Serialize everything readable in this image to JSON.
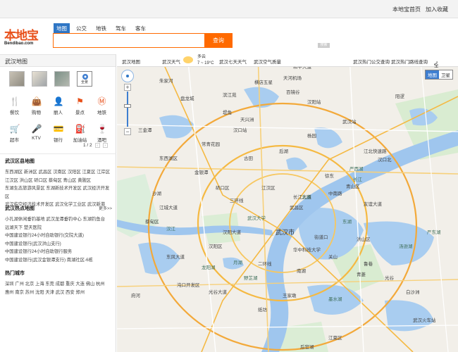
{
  "topbar": {
    "home": "本地宝首页",
    "fav": "加入收藏"
  },
  "logo": {
    "cn": "本地宝",
    "en": "Bendibao.com"
  },
  "search": {
    "tabs": [
      "地图",
      "公交",
      "地铁",
      "驾车",
      "客车"
    ],
    "button": "查询",
    "small_button": "搜索"
  },
  "sidebar": {
    "title": "武汉地图",
    "thumbs": [
      "",
      "",
      "",
      "全景"
    ],
    "poi": [
      "餐饮",
      "购物",
      "丽人",
      "景点",
      "地铁",
      "超市",
      "KTV",
      "银行",
      "加油站",
      "酒吧"
    ],
    "pager": {
      "text": "1 / 2",
      "prev": "‹",
      "next": "›"
    },
    "districts": {
      "title": "武汉区县地图",
      "lines": [
        "东西湖区 新洲区 武昌区 汉南区 汉阳区 江夏区 江岸区",
        "江汉区 洪山区 硚口区 蔡甸区 青山区 黄陂区",
        "东湖生态旅游风景区 东湖新技术开发区 武汉经济开发区",
        "武汉临空经济技术开发区 武汉化学工业区 武汉新港"
      ]
    },
    "hot": {
      "title": "武汉热点地图",
      "more": "更多>>",
      "lines": [
        "小孔湖休闲垂钓基地 武汉龙潭垂钓中心 东湖钓鱼台",
        "远湖天下 楚天医院",
        "中国建设银行24小时自助银行(交院大道)",
        "中国建设银行(武汉洪山支行)",
        "中国建设银行24小时自助银行服务",
        "中国建设银行(武汉金银潭支行) 南湖社区-6栋"
      ]
    },
    "cities": {
      "title": "热门城市",
      "lines": [
        "深圳 广州 北京 上海 东莞 成都 重庆 大连 佛山 杭州",
        "惠州 南京 苏州 沈阳 天津 武汉 西安 郑州"
      ]
    }
  },
  "mapbar": {
    "title": "武汉地图",
    "weather_link": "武汉天气",
    "weather": {
      "cond": "多云",
      "temp": "7 ~ 19°C"
    },
    "week": "武汉七天天气",
    "air": "武汉空气质量",
    "bus": "武汉热门公交查询",
    "route": "武汉热门路线查询",
    "full": "全屏"
  },
  "maptype": [
    "地图",
    "卫星"
  ],
  "zoom": {
    "plus": "+",
    "minus": "−"
  },
  "map_labels": [
    "天河机场",
    "滨江苑",
    "横店五星",
    "百镜谷",
    "武汉站",
    "阳逻",
    "汉口站",
    "江汉区",
    "硚口区",
    "东西湖区",
    "汉阳区",
    "武昌区",
    "武汉市",
    "青山区",
    "洪山区",
    "蔡甸区",
    "沌口开发区",
    "江夏区",
    "南湖",
    "后湖",
    "盘龙城",
    "常青花园",
    "三环线",
    "二环线",
    "长江",
    "汉江",
    "东湖",
    "汤逊湖",
    "墨水湖",
    "月湖",
    "武汉大学",
    "华中科技大学",
    "光谷",
    "白沙洲",
    "王家墩",
    "古田",
    "金银潭",
    "堤角",
    "杨园",
    "徐东",
    "中南路",
    "街道口",
    "关山",
    "鲁巷",
    "青菱",
    "纸坊",
    "后官湖",
    "府河",
    "朱家河",
    "三金潭",
    "天兴洲",
    "江北快速路",
    "汉口北",
    "和平大道",
    "友谊大道",
    "长江大道",
    "江城大道",
    "光谷大道",
    "武汉火车站",
    "汉阳站",
    "汉阳大道",
    "东风大道",
    "沙湖",
    "北湖",
    "严西湖",
    "严东湖",
    "龙阳湖",
    "野芷湖"
  ]
}
